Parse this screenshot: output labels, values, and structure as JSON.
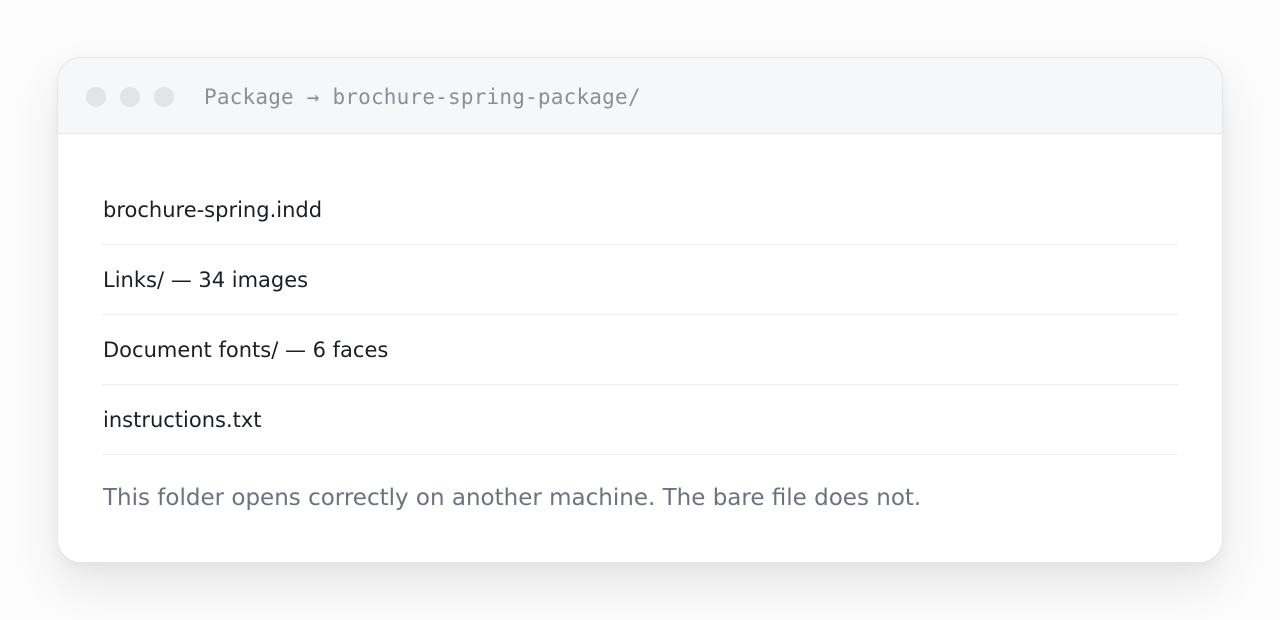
{
  "window": {
    "path_root": "Package",
    "path_arrow": "→",
    "path_folder": "brochure-spring-package/"
  },
  "files": [
    {
      "label": "brochure-spring.indd"
    },
    {
      "label": "Links/ — 34 images"
    },
    {
      "label": "Document fonts/ — 6 faces"
    },
    {
      "label": "instructions.txt"
    }
  ],
  "note": "This folder opens correctly on another machine. The bare file does not.",
  "colors": {
    "titlebar_bg": "#f6f7f9",
    "traffic_light": "#e2e4e8",
    "path_text": "#8a9099",
    "file_text": "#1b1f24",
    "note_text": "#6b7280"
  }
}
